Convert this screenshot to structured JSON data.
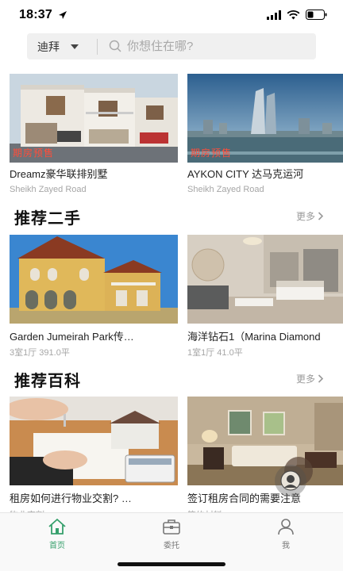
{
  "status": {
    "time": "18:37"
  },
  "search": {
    "city": "迪拜",
    "placeholder": "你想住在哪?"
  },
  "top_cards": [
    {
      "title": "Dreamz豪华联排别墅",
      "subtitle": "Sheikh Zayed Road",
      "tag": "期房预售"
    },
    {
      "title": "AYKON CITY 达马克运河",
      "subtitle": "Sheikh Zayed Road",
      "tag": "期房预售"
    }
  ],
  "second_hand": {
    "title": "推荐二手",
    "more": "更多",
    "cards": [
      {
        "title": "Garden Jumeirah Park传…",
        "subtitle": "3室1厅 391.0平"
      },
      {
        "title": "海洋钻石1（Marina Diamond",
        "subtitle": "1室1厅 41.0平"
      }
    ]
  },
  "encyclopedia": {
    "title": "推荐百科",
    "more": "更多",
    "cards": [
      {
        "title": "租房如何进行物业交割? …",
        "subtitle": "物业交割"
      },
      {
        "title": "签订租房合同的需要注意",
        "subtitle": "签约材料"
      }
    ]
  },
  "tabs": [
    {
      "label": "首页",
      "icon": "home-icon",
      "active": true
    },
    {
      "label": "委托",
      "icon": "briefcase-icon",
      "active": false
    },
    {
      "label": "我",
      "icon": "user-icon",
      "active": false
    }
  ],
  "colors": {
    "accent": "#36a06c",
    "tag": "#ff4d3a",
    "muted": "#a6a6a6"
  }
}
